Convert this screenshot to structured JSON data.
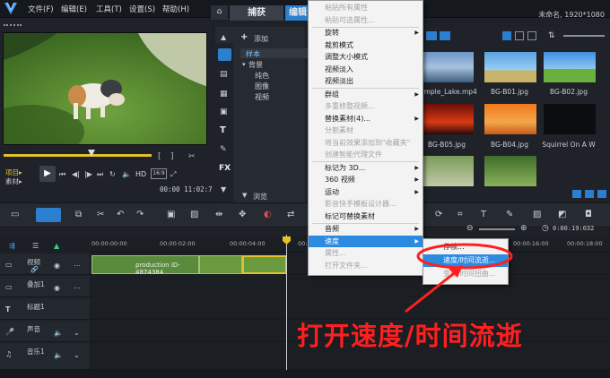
{
  "menubar": {
    "file": "文件(F)",
    "edit": "编辑(E)",
    "tools": "工具(T)",
    "settings": "设置(S)",
    "help": "帮助(H)"
  },
  "project_info": "未命名, 1920*1080",
  "tabs": {
    "capture": "捕获",
    "edit": "编辑"
  },
  "preview": {
    "mode_project": "项目▸",
    "mode_clip": "素材▸",
    "hd": "HD",
    "timecode": "00:00 11:02:7"
  },
  "library": {
    "add": "添加",
    "items": [
      "样本",
      "背景",
      "纯色",
      "图像",
      "视频"
    ],
    "browse": "浏览",
    "fx": "FX"
  },
  "thumbnails": [
    {
      "name": "ample_Lake.mp4"
    },
    {
      "name": "BG-B01.jpg"
    },
    {
      "name": "BG-B02.jpg"
    },
    {
      "name": "BG-B05.jpg"
    },
    {
      "name": "BG-B04.jpg"
    },
    {
      "name": "Squirrel On A W"
    }
  ],
  "timeline": {
    "ruler": [
      "00:00:00:00",
      "00:00:02:00",
      "00:00:04:00",
      "00:00:06:00",
      "00:00:16:00",
      "00:00:18:00"
    ],
    "tracks": [
      "视频",
      "叠加1",
      "标题1",
      "声音",
      "音乐1"
    ],
    "clip_label": "production ID-4874384",
    "timecode": "0:00:19:032"
  },
  "context_menu": {
    "items": [
      {
        "label": "粘贴所有属性",
        "disabled": true
      },
      {
        "label": "粘贴可选属性...",
        "disabled": true
      },
      {
        "label": "旋转",
        "arrow": true
      },
      {
        "label": "裁剪模式"
      },
      {
        "label": "调整大小模式"
      },
      {
        "label": "视频淡入"
      },
      {
        "label": "视频淡出"
      },
      {
        "label": "群组",
        "arrow": true
      },
      {
        "label": "多重修整视频...",
        "disabled": true
      },
      {
        "label": "替换素材(4)...",
        "arrow": true
      },
      {
        "label": "分割素材",
        "disabled": true
      },
      {
        "label": "将当前效果添加到\"收藏夹\"",
        "disabled": true
      },
      {
        "label": "创建智能代理文件",
        "disabled": true
      },
      {
        "label": "标记为 3D...",
        "arrow": true
      },
      {
        "label": "360 视频",
        "arrow": true
      },
      {
        "label": "运动",
        "arrow": true
      },
      {
        "label": "影音快手模板设计器...",
        "disabled": true
      },
      {
        "label": "标记可替换素材"
      },
      {
        "label": "音频",
        "arrow": true
      },
      {
        "label": "速度",
        "arrow": true,
        "selected": true
      },
      {
        "label": "属性...",
        "disabled": true
      },
      {
        "label": "打开文件夹...",
        "disabled": true
      }
    ],
    "submenu": [
      {
        "label": "停帧..."
      },
      {
        "label": "速度/时间流逝...",
        "selected": true
      },
      {
        "label": "变速/时间扭曲...",
        "disabled": true
      }
    ]
  },
  "annotation": "打开速度/时间流逝",
  "colors": {
    "accent": "#2c8ae0",
    "annotation": "#ff1f1f",
    "playhead": "#e2c12a"
  }
}
